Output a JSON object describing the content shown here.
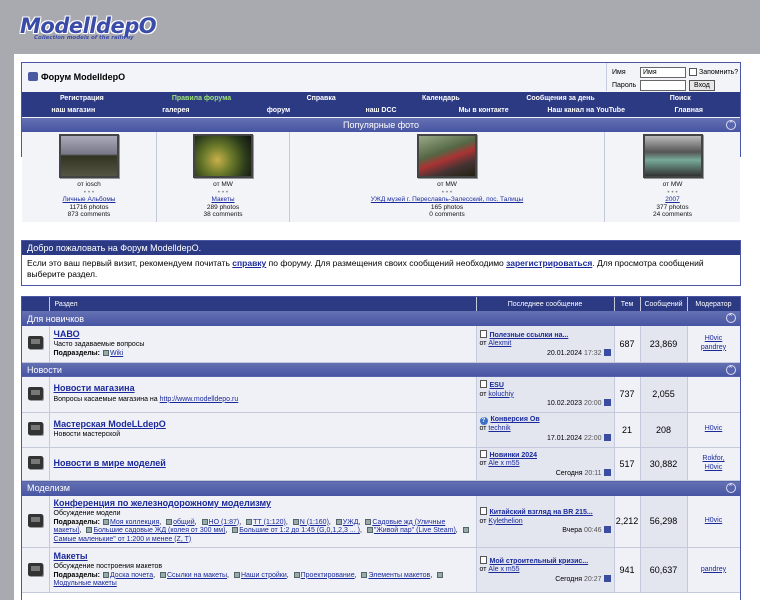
{
  "logo": {
    "title": "ModelldepO",
    "tagline": "Collection models of the railway"
  },
  "header": {
    "forum_title": "Форум ModelldepO"
  },
  "login": {
    "user_label": "Имя",
    "user_value": "Имя",
    "remember_label": "Запомнить?",
    "pass_label": "Пароль",
    "login_button": "Вход"
  },
  "nav_top": [
    "Регистрация",
    "Правила форума",
    "Справка",
    "Календарь",
    "Сообщения за день",
    "Поиск"
  ],
  "nav_bottom": [
    "наш магазин",
    "галерея",
    "форум",
    "наш DCC",
    "Мы в контакте",
    "Наш канал на YouTube",
    "Главная"
  ],
  "popular": {
    "title": "Популярные фото",
    "items": [
      {
        "by": "от iosch",
        "dots": "• • •",
        "album": "Личные Альбомы",
        "photos": "11716 photos",
        "comments": "873 comments"
      },
      {
        "by": "от MW",
        "dots": "• • •",
        "album": "Макеты",
        "photos": "289 photos",
        "comments": "38 comments"
      },
      {
        "by": "от MW",
        "dots": "• • •",
        "album": "УЖД музей г. Переславль-Залесский, пос. Талицы",
        "photos": "165 photos",
        "comments": "0 comments"
      },
      {
        "by": "от MW",
        "dots": "• • •",
        "album": "2007",
        "photos": "377 photos",
        "comments": "24 comments"
      }
    ]
  },
  "welcome": {
    "title": "Добро пожаловать на Форум ModelldepO.",
    "text1": "Если это ваш первый визит, рекомендуем почитать ",
    "link1": "справку",
    "text2": " по форуму. Для размещения своих сообщений необходимо ",
    "link2": "зарегистрироваться",
    "text3": ". Для просмотра сообщений выберите раздел."
  },
  "columns": {
    "section": "Раздел",
    "last_post": "Последнее сообщение",
    "topics": "Тем",
    "posts": "Сообщений",
    "moderator": "Модератор"
  },
  "categories": [
    {
      "name": "Для новичков",
      "forums": [
        {
          "title": "ЧАВО",
          "desc": "Часто задаваемые вопросы",
          "subs_label": "Подразделы:",
          "subs": [
            "Wiki"
          ],
          "last_title": "Полезные ссылки на...",
          "last_by_prefix": "от",
          "last_by": "Alexmit",
          "last_date": "20.01.2024",
          "last_time": "17:32",
          "topics": "687",
          "posts": "23,869",
          "mods": [
            "H0vic",
            "pandrey"
          ],
          "icon": "doc"
        }
      ]
    },
    {
      "name": "Новости",
      "forums": [
        {
          "title": "Новости магазина",
          "desc": "Вопросы касаемые магазина на ",
          "desc_link": "http://www.modelldepo.ru",
          "last_title": "ESU",
          "last_by_prefix": "от",
          "last_by": "koluchiy",
          "last_date": "10.02.2023",
          "last_time": "20:00",
          "topics": "737",
          "posts": "2,055",
          "mods": [],
          "icon": "doc"
        },
        {
          "title": "Мастерская ModeLLdepO",
          "desc": "Новости мастерской",
          "last_title": "Конверсия Ов",
          "last_by_prefix": "от",
          "last_by": "technik",
          "last_date": "17.01.2024",
          "last_time": "22:00",
          "topics": "21",
          "posts": "208",
          "mods": [
            "H0vic"
          ],
          "icon": "q"
        },
        {
          "title": "Новости в мире моделей",
          "desc": "",
          "last_title": "Новинки 2024",
          "last_by_prefix": "от",
          "last_by": "Ale x m55",
          "last_date": "Сегодня",
          "last_time": "20:11",
          "topics": "517",
          "posts": "30,882",
          "mods": [
            "Rokfor,",
            "H0vic"
          ],
          "icon": "doc"
        }
      ]
    },
    {
      "name": "Моделизм",
      "forums": [
        {
          "title": "Конференция по железнодорожному моделизму",
          "desc": "Обсуждение модели",
          "subs_label": "Подразделы:",
          "subs": [
            "Моя коллекция",
            "общий",
            "НО (1:87)",
            "ТТ (1:120)",
            "N (1:160)",
            "УЖД",
            "Садовые жд (Уличные макеты)",
            "Большие садовые ЖД (колея от 300 мм)",
            "Большие от 1:2 до 1:45 (G,0,1,2,3 ... )",
            "\"Живой пар\" (Live Steam)",
            "Самые маленькие\" от 1:200 и менее (Z, T)"
          ],
          "last_title": "Китайский взгляд на BR 215...",
          "last_by_prefix": "от",
          "last_by": "Kylethelion",
          "last_date": "Вчера",
          "last_time": "00:46",
          "topics": "2,212",
          "posts": "56,298",
          "mods": [
            "H0vic"
          ],
          "icon": "doc"
        },
        {
          "title": "Макеты",
          "desc": "Обсуждение построения макетов",
          "subs_label": "Подразделы:",
          "subs": [
            "Доска почета",
            "Ссылки на макеты",
            "Наши стройки",
            "Проектирование",
            "Элементы макетов",
            "Модульные макеты"
          ],
          "last_title": "Мой строительный кризис...",
          "last_by_prefix": "от",
          "last_by": "Ale x m55",
          "last_date": "Сегодня",
          "last_time": "20:27",
          "topics": "941",
          "posts": "60,637",
          "mods": [
            "pandrey"
          ],
          "icon": "doc"
        }
      ]
    }
  ],
  "colors": {
    "nav_bg": "#2c3a84",
    "cat_bg": "#4754a2",
    "page_bg": "#a9aab0",
    "rules_link": "#9ee57a"
  }
}
